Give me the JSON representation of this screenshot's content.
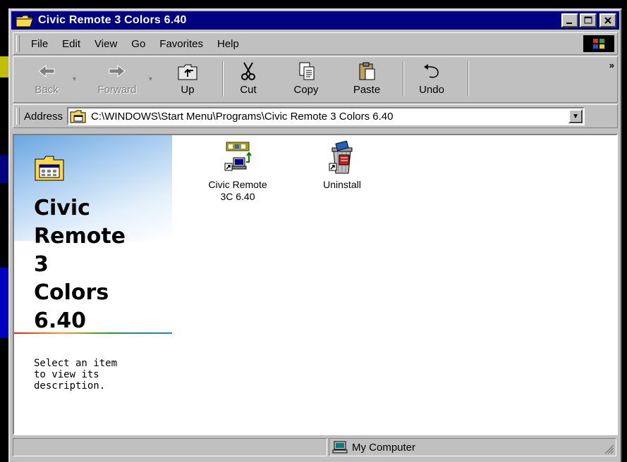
{
  "window": {
    "title": "Civic Remote 3 Colors 6.40",
    "buttons": [
      "minimize-icon",
      "maximize-icon",
      "close-icon"
    ]
  },
  "menu": {
    "items": [
      {
        "label": "File"
      },
      {
        "label": "Edit"
      },
      {
        "label": "View"
      },
      {
        "label": "Go"
      },
      {
        "label": "Favorites"
      },
      {
        "label": "Help"
      }
    ]
  },
  "toolbar": {
    "back": "Back",
    "forward": "Forward",
    "up": "Up",
    "cut": "Cut",
    "copy": "Copy",
    "paste": "Paste",
    "undo": "Undo",
    "more": "»"
  },
  "address": {
    "label": "Address",
    "value": "C:\\WINDOWS\\Start Menu\\Programs\\Civic Remote 3 Colors 6.40"
  },
  "webview": {
    "title_lines": [
      "Civic",
      "Remote",
      "3",
      "Colors",
      "6.40"
    ],
    "description_lines": [
      "Select an item",
      "to view its",
      "description."
    ]
  },
  "files": [
    {
      "line1": "Civic Remote",
      "line2": "3C 6.40",
      "icon": "civic-remote-shortcut-icon"
    },
    {
      "line1": "Uninstall",
      "line2": "",
      "icon": "uninstall-shortcut-icon"
    }
  ],
  "status": {
    "zone": "My Computer"
  },
  "colors": {
    "titlebar": "#000080",
    "face": "#c0c0c0"
  }
}
